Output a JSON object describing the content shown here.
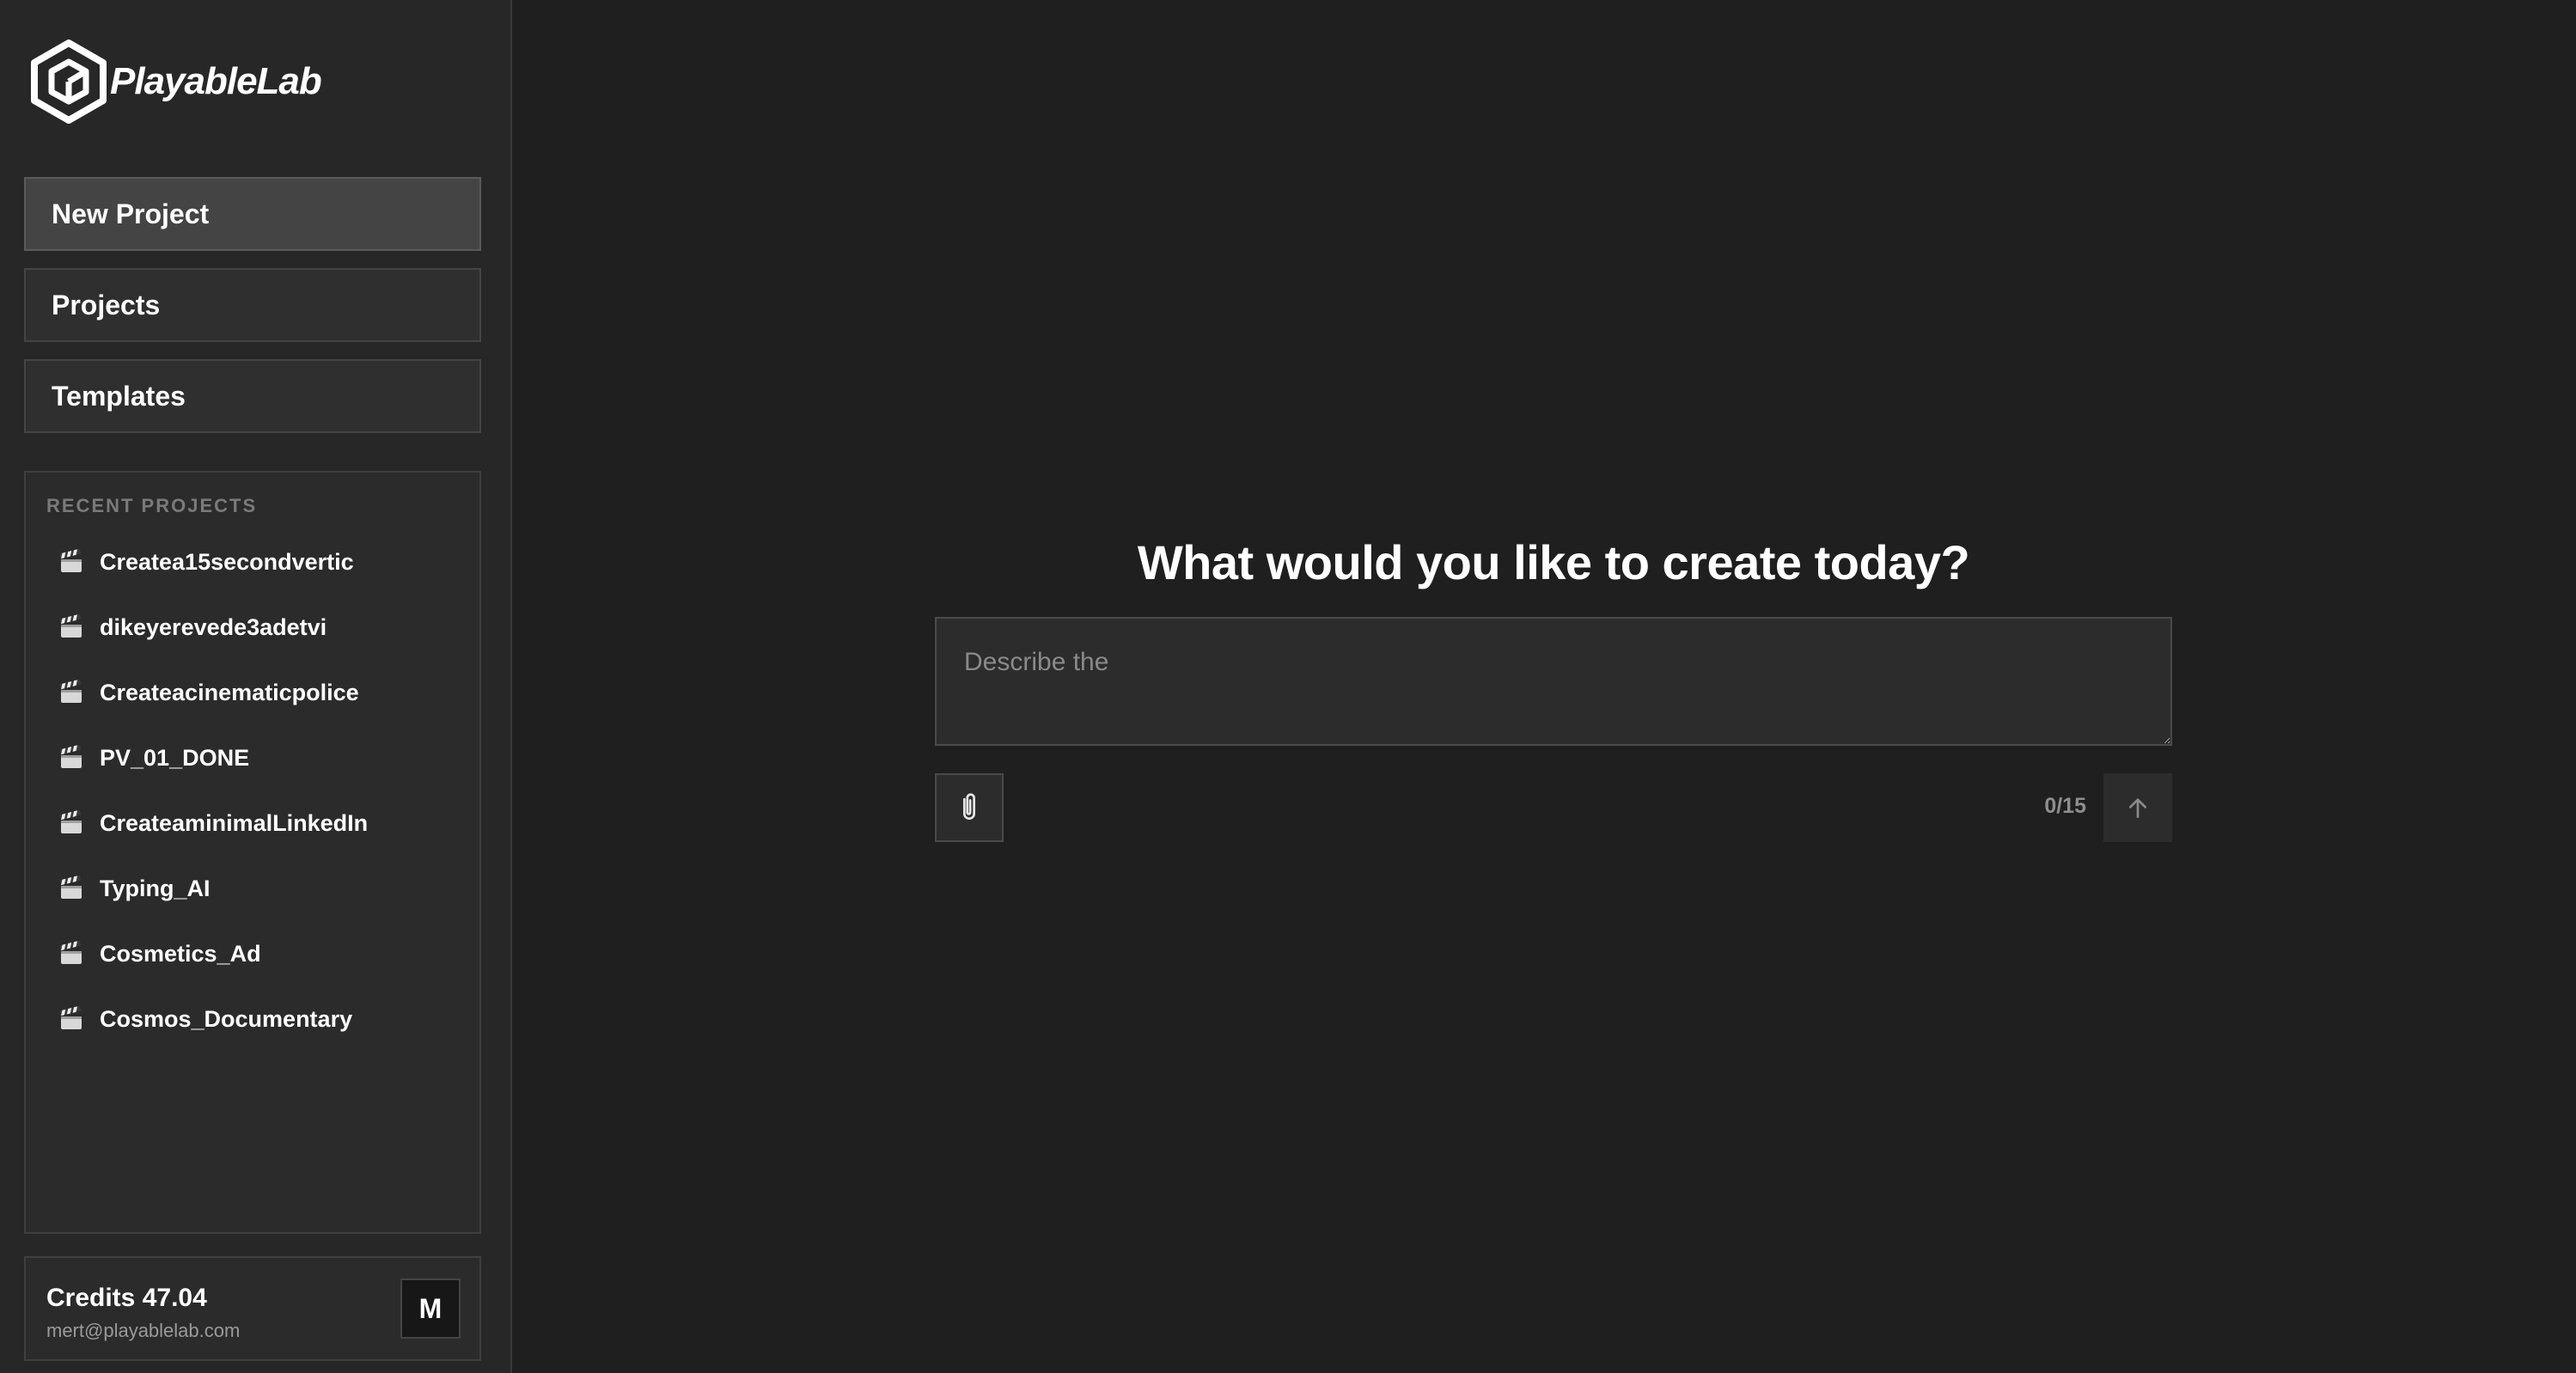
{
  "app": {
    "brand": "PlayableLab",
    "accent_color": "#ffffff",
    "background_color": "#1f1f1f",
    "sidebar_color": "#272727"
  },
  "sidebar": {
    "nav": [
      {
        "label": "New Project",
        "icon": null,
        "active": true
      },
      {
        "label": "Projects",
        "active": false
      },
      {
        "label": "Templates",
        "active": false
      }
    ],
    "recent_title": "RECENT PROJECTS",
    "recent_icon": "clapperboard-icon",
    "recent_projects": [
      "Createa15secondvertic",
      "dikeyerevede3adetvi",
      "Createacinematicpolice",
      "PV_01_DONE",
      "CreateaminimalLinkedIn",
      "Typing_AI",
      "Cosmetics_Ad",
      "Cosmos_Documentary"
    ],
    "account": {
      "credits_label": "Credits 47.04",
      "email": "mert@playablelab.com",
      "avatar_initial": "M"
    }
  },
  "main": {
    "heading": "What would you like to create today?",
    "prompt": {
      "value": "",
      "placeholder": "Describe the"
    },
    "attach_icon": "paperclip-icon",
    "counter": "0/15",
    "send_icon": "arrow-up-icon"
  }
}
